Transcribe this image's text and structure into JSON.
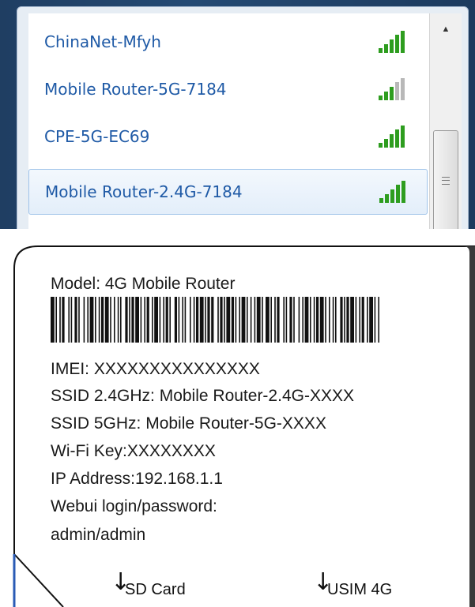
{
  "wifi": {
    "networks": [
      {
        "name": "ChinaNet-Mfyh",
        "signal_bars": 5,
        "signal_icon": "wifi-signal-strong-icon",
        "selected": false
      },
      {
        "name": "Mobile Router-5G-7184",
        "signal_bars": 3,
        "signal_icon": "wifi-signal-medium-icon",
        "selected": false
      },
      {
        "name": "CPE-5G-EC69",
        "signal_bars": 5,
        "signal_icon": "wifi-signal-strong-icon",
        "selected": false
      },
      {
        "name": "Mobile Router-2.4G-7184",
        "signal_bars": 5,
        "signal_icon": "wifi-signal-strong-icon",
        "selected": true
      }
    ],
    "colors": {
      "link": "#1f5aa6",
      "signal": "#2e9d1f",
      "signal_inactive": "#b8b8b8",
      "frame": "#244a74"
    }
  },
  "device_label": {
    "model": "Model: 4G Mobile Router",
    "imei": "IMEI: XXXXXXXXXXXXXXX",
    "ssid_24": "SSID 2.4GHz: Mobile Router-2.4G-XXXX",
    "ssid_5": "SSID 5GHz: Mobile Router-5G-XXXX",
    "wifi_key": "Wi-Fi Key:XXXXXXXX",
    "ip_address": "IP Address:192.168.1.1",
    "webui_label": "Webui login/password:",
    "webui_credentials": "admin/admin",
    "sd_card": "SD Card",
    "usim": "USIM 4G",
    "arrow_icon": "arrow-down-icon"
  }
}
